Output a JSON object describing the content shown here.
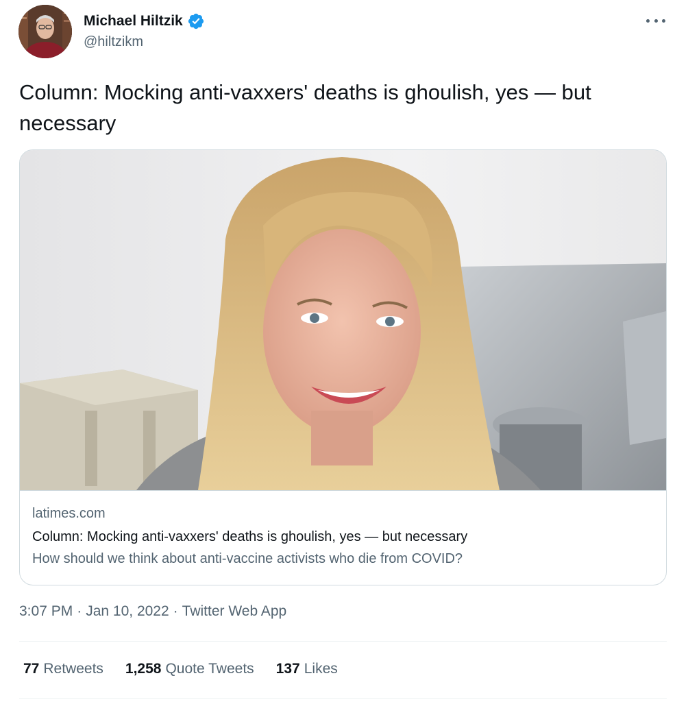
{
  "author": {
    "display_name": "Michael Hiltzik",
    "handle": "@hiltzikm",
    "verified": true,
    "verified_color": "#1d9bf0"
  },
  "tweet": {
    "text": "Column: Mocking anti-vaxxers' deaths is ghoulish, yes — but necessary"
  },
  "card": {
    "domain": "latimes.com",
    "title": "Column: Mocking anti-vaxxers' deaths is ghoulish, yes — but necessary",
    "description": "How should we think about anti-vaccine activists who die from COVID?"
  },
  "meta": {
    "time": "3:07 PM",
    "separator": "·",
    "date": "Jan 10, 2022",
    "source": "Twitter Web App"
  },
  "stats": {
    "retweets_count": "77",
    "retweets_label": "Retweets",
    "quotes_count": "1,258",
    "quotes_label": "Quote Tweets",
    "likes_count": "137",
    "likes_label": "Likes"
  },
  "icons": {
    "more": "more-icon",
    "verified": "verified-badge-icon"
  }
}
